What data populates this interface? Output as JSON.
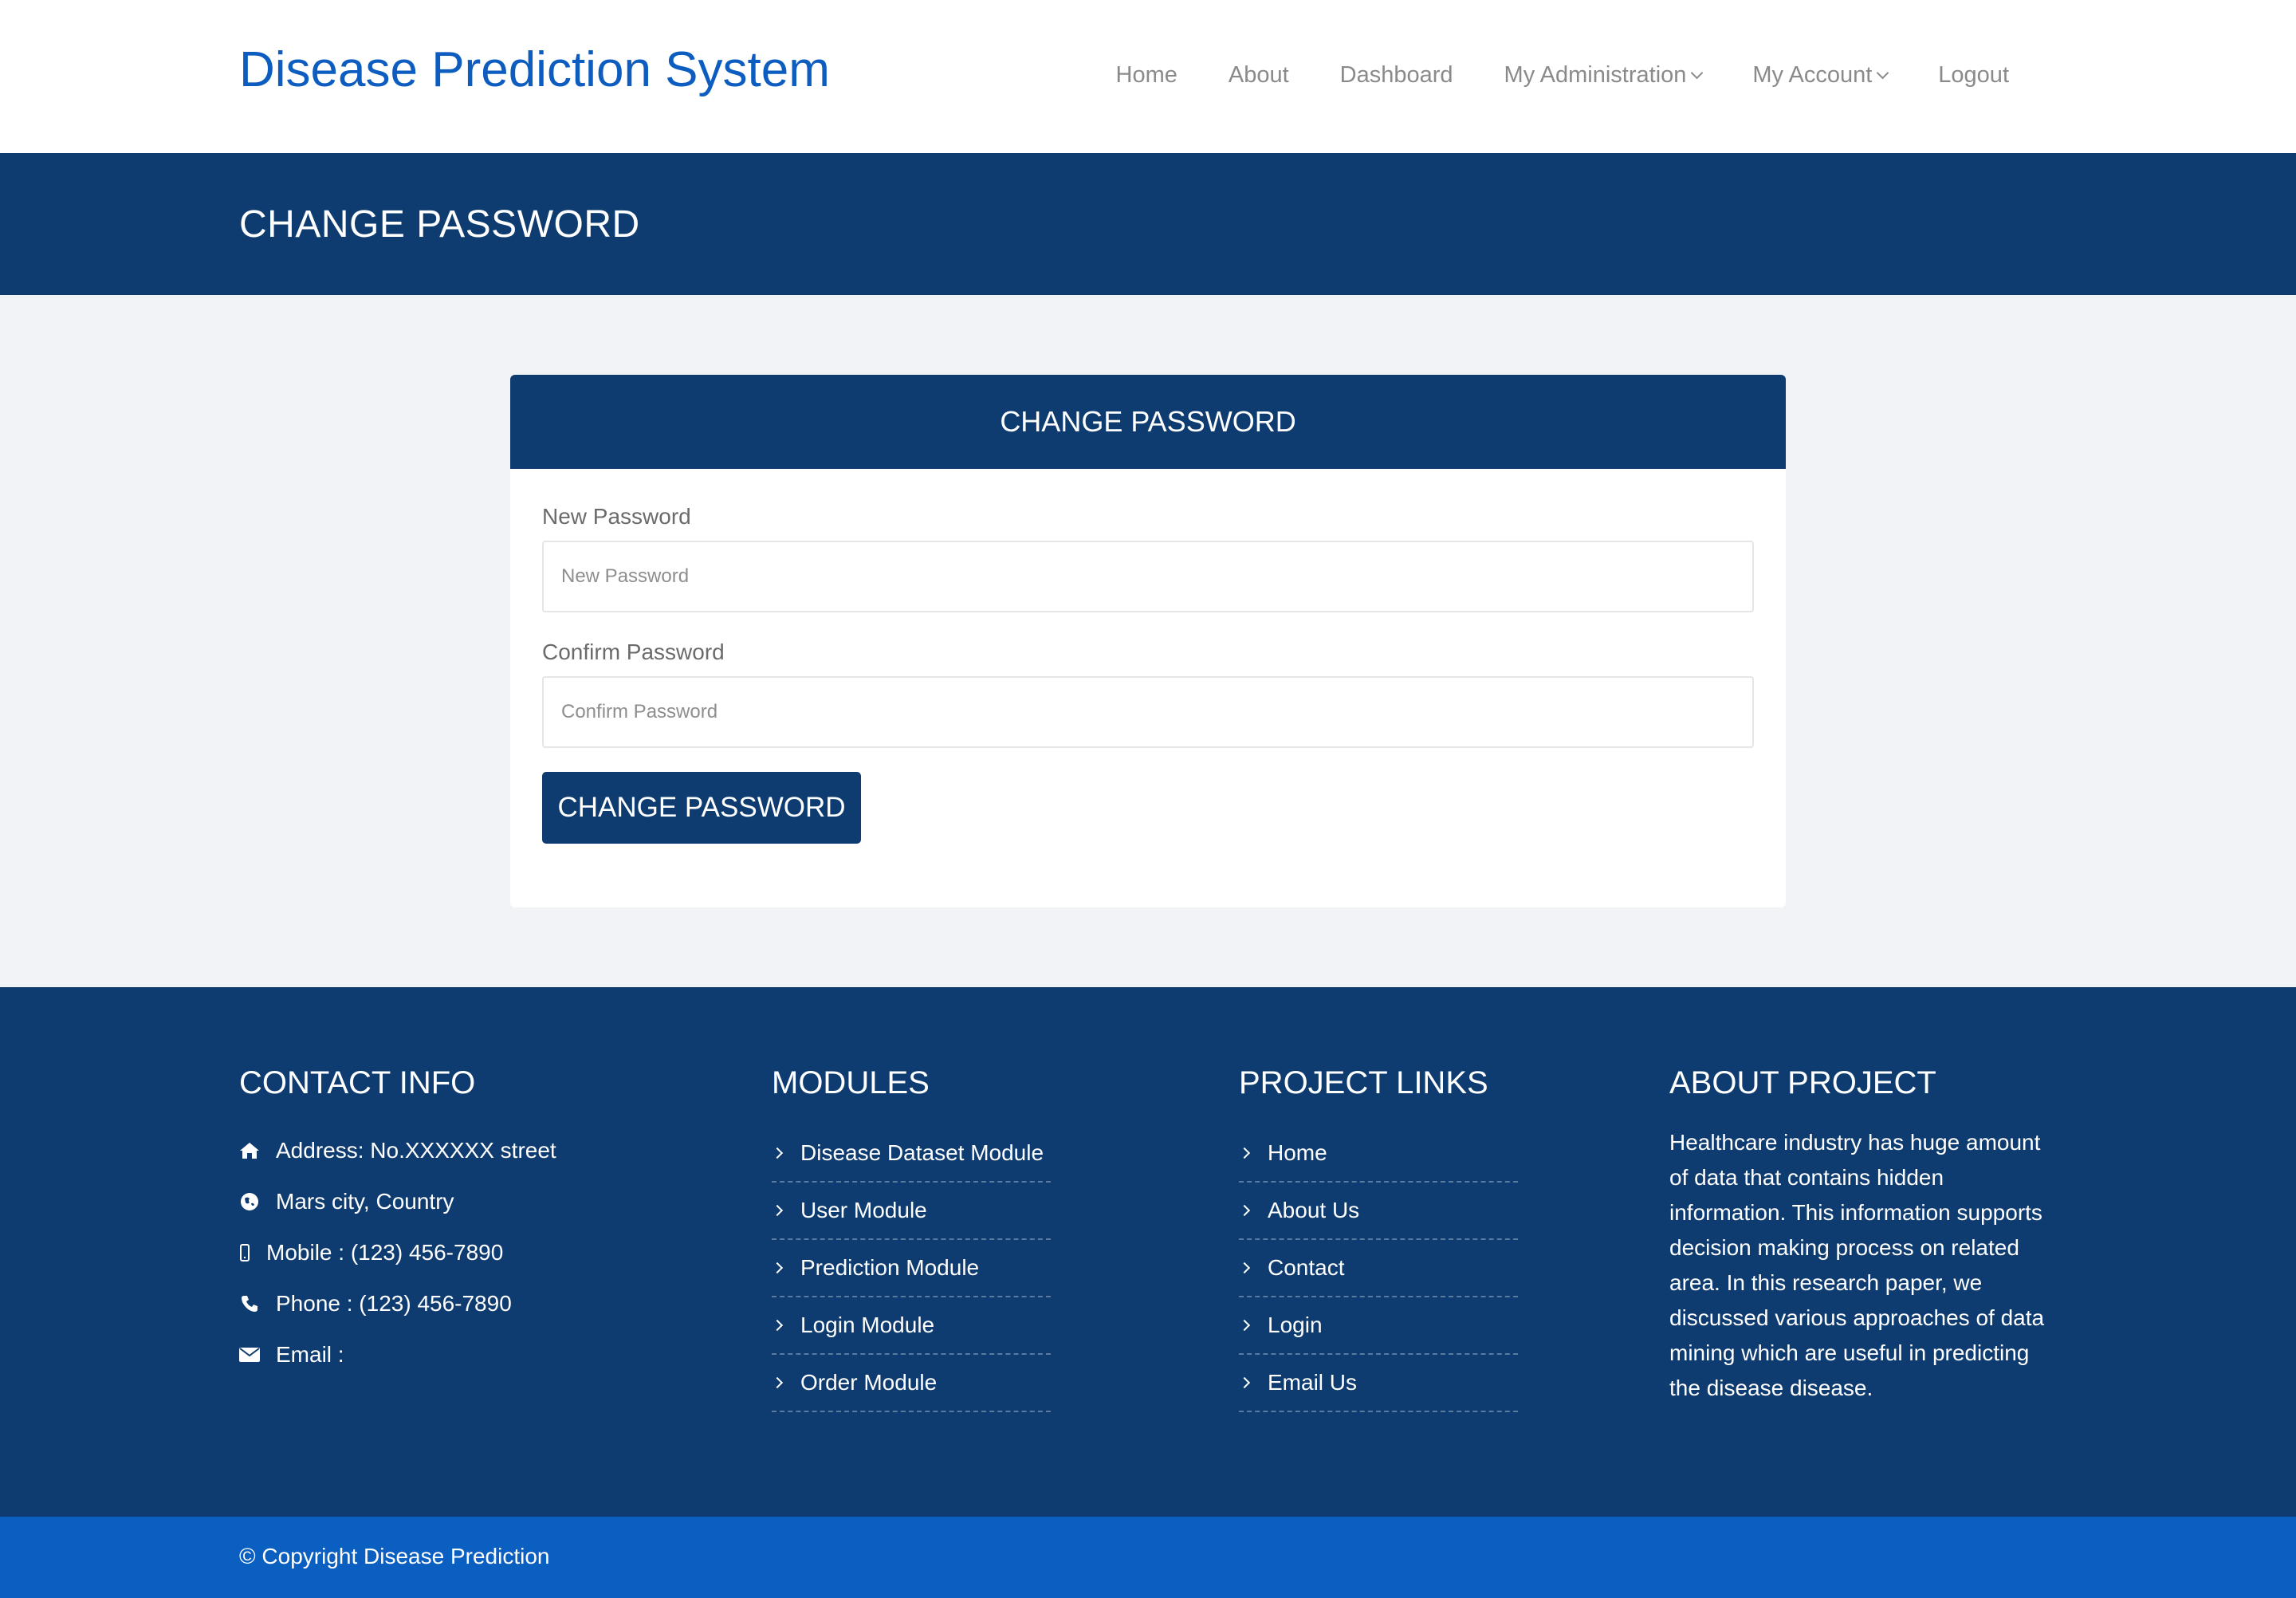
{
  "header": {
    "brand": "Disease Prediction System",
    "nav": [
      {
        "label": "Home"
      },
      {
        "label": "About"
      },
      {
        "label": "Dashboard"
      },
      {
        "label": "My Administration"
      },
      {
        "label": "My Account"
      },
      {
        "label": "Logout"
      }
    ]
  },
  "banner": {
    "title": "CHANGE PASSWORD"
  },
  "form": {
    "heading": "CHANGE PASSWORD",
    "new_label": "New Password",
    "new_placeholder": "New Password",
    "new_value": "",
    "confirm_label": "Confirm Password",
    "confirm_placeholder": "Confirm Password",
    "confirm_value": "",
    "submit_label": "CHANGE PASSWORD"
  },
  "footer": {
    "contact": {
      "title": "CONTACT INFO",
      "rows": [
        {
          "icon": "home-icon",
          "text": "Address: No.XXXXXX street"
        },
        {
          "icon": "globe-icon",
          "text": "Mars city, Country"
        },
        {
          "icon": "mobile-icon",
          "text": "Mobile : (123) 456-7890"
        },
        {
          "icon": "phone-icon",
          "text": "Phone : (123) 456-7890"
        },
        {
          "icon": "envelope-icon",
          "text": "Email :"
        }
      ]
    },
    "modules": {
      "title": "MODULES",
      "items": [
        "Disease Dataset Module",
        "User Module",
        "Prediction Module",
        "Login Module",
        "Order Module"
      ]
    },
    "project_links": {
      "title": "PROJECT LINKS",
      "items": [
        "Home",
        "About Us",
        "Contact",
        "Login",
        "Email Us"
      ]
    },
    "about": {
      "title": "ABOUT PROJECT",
      "text": "Healthcare industry has huge amount of data that contains hidden information. This information supports decision making process on related area. In this research paper, we discussed various approaches of data mining which are useful in predicting the disease disease."
    },
    "copyright": "© Copyright Disease Prediction"
  },
  "colors": {
    "brand": "#0d5cbf",
    "navy": "#0e3c70",
    "copyright_bar": "#0a5fc1",
    "page_bg": "#f1f3f7"
  }
}
